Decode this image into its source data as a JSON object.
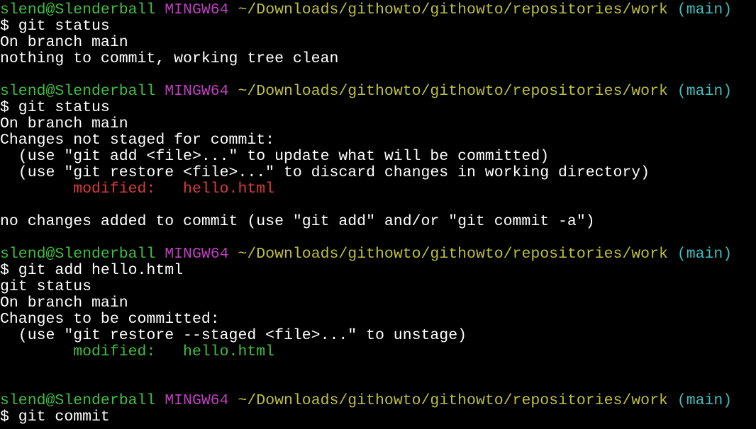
{
  "colors": {
    "background": "#000000",
    "text": "#ffffff",
    "user_host": "#3fbf3f",
    "shell": "#bf3fbf",
    "path": "#bfbf3f",
    "branch": "#3fbfbf",
    "unstaged": "#d93b3b",
    "staged": "#3fbf3f"
  },
  "prompt": {
    "user_host": "slend@Slenderball",
    "shell": "MINGW64",
    "path": "~/Downloads/githowto/githowto/repositories/work",
    "branch": "(main)"
  },
  "block1": {
    "cmd": "$ git status",
    "out1": "On branch main",
    "out2": "nothing to commit, working tree clean"
  },
  "block2": {
    "cmd": "$ git status",
    "out1": "On branch main",
    "out2": "Changes not staged for commit:",
    "hint1": "  (use \"git add <file>...\" to update what will be committed)",
    "hint2": "  (use \"git restore <file>...\" to discard changes in working directory)",
    "mod_label": "        modified:   ",
    "mod_file": "hello.html",
    "summary": "no changes added to commit (use \"git add\" and/or \"git commit -a\")"
  },
  "block3": {
    "cmd": "$ git add hello.html",
    "cmd2": "git status",
    "out1": "On branch main",
    "out2": "Changes to be committed:",
    "hint1": "  (use \"git restore --staged <file>...\" to unstage)",
    "mod_label": "        modified:   ",
    "mod_file": "hello.html"
  },
  "block4": {
    "cmd": "$ git commit"
  }
}
